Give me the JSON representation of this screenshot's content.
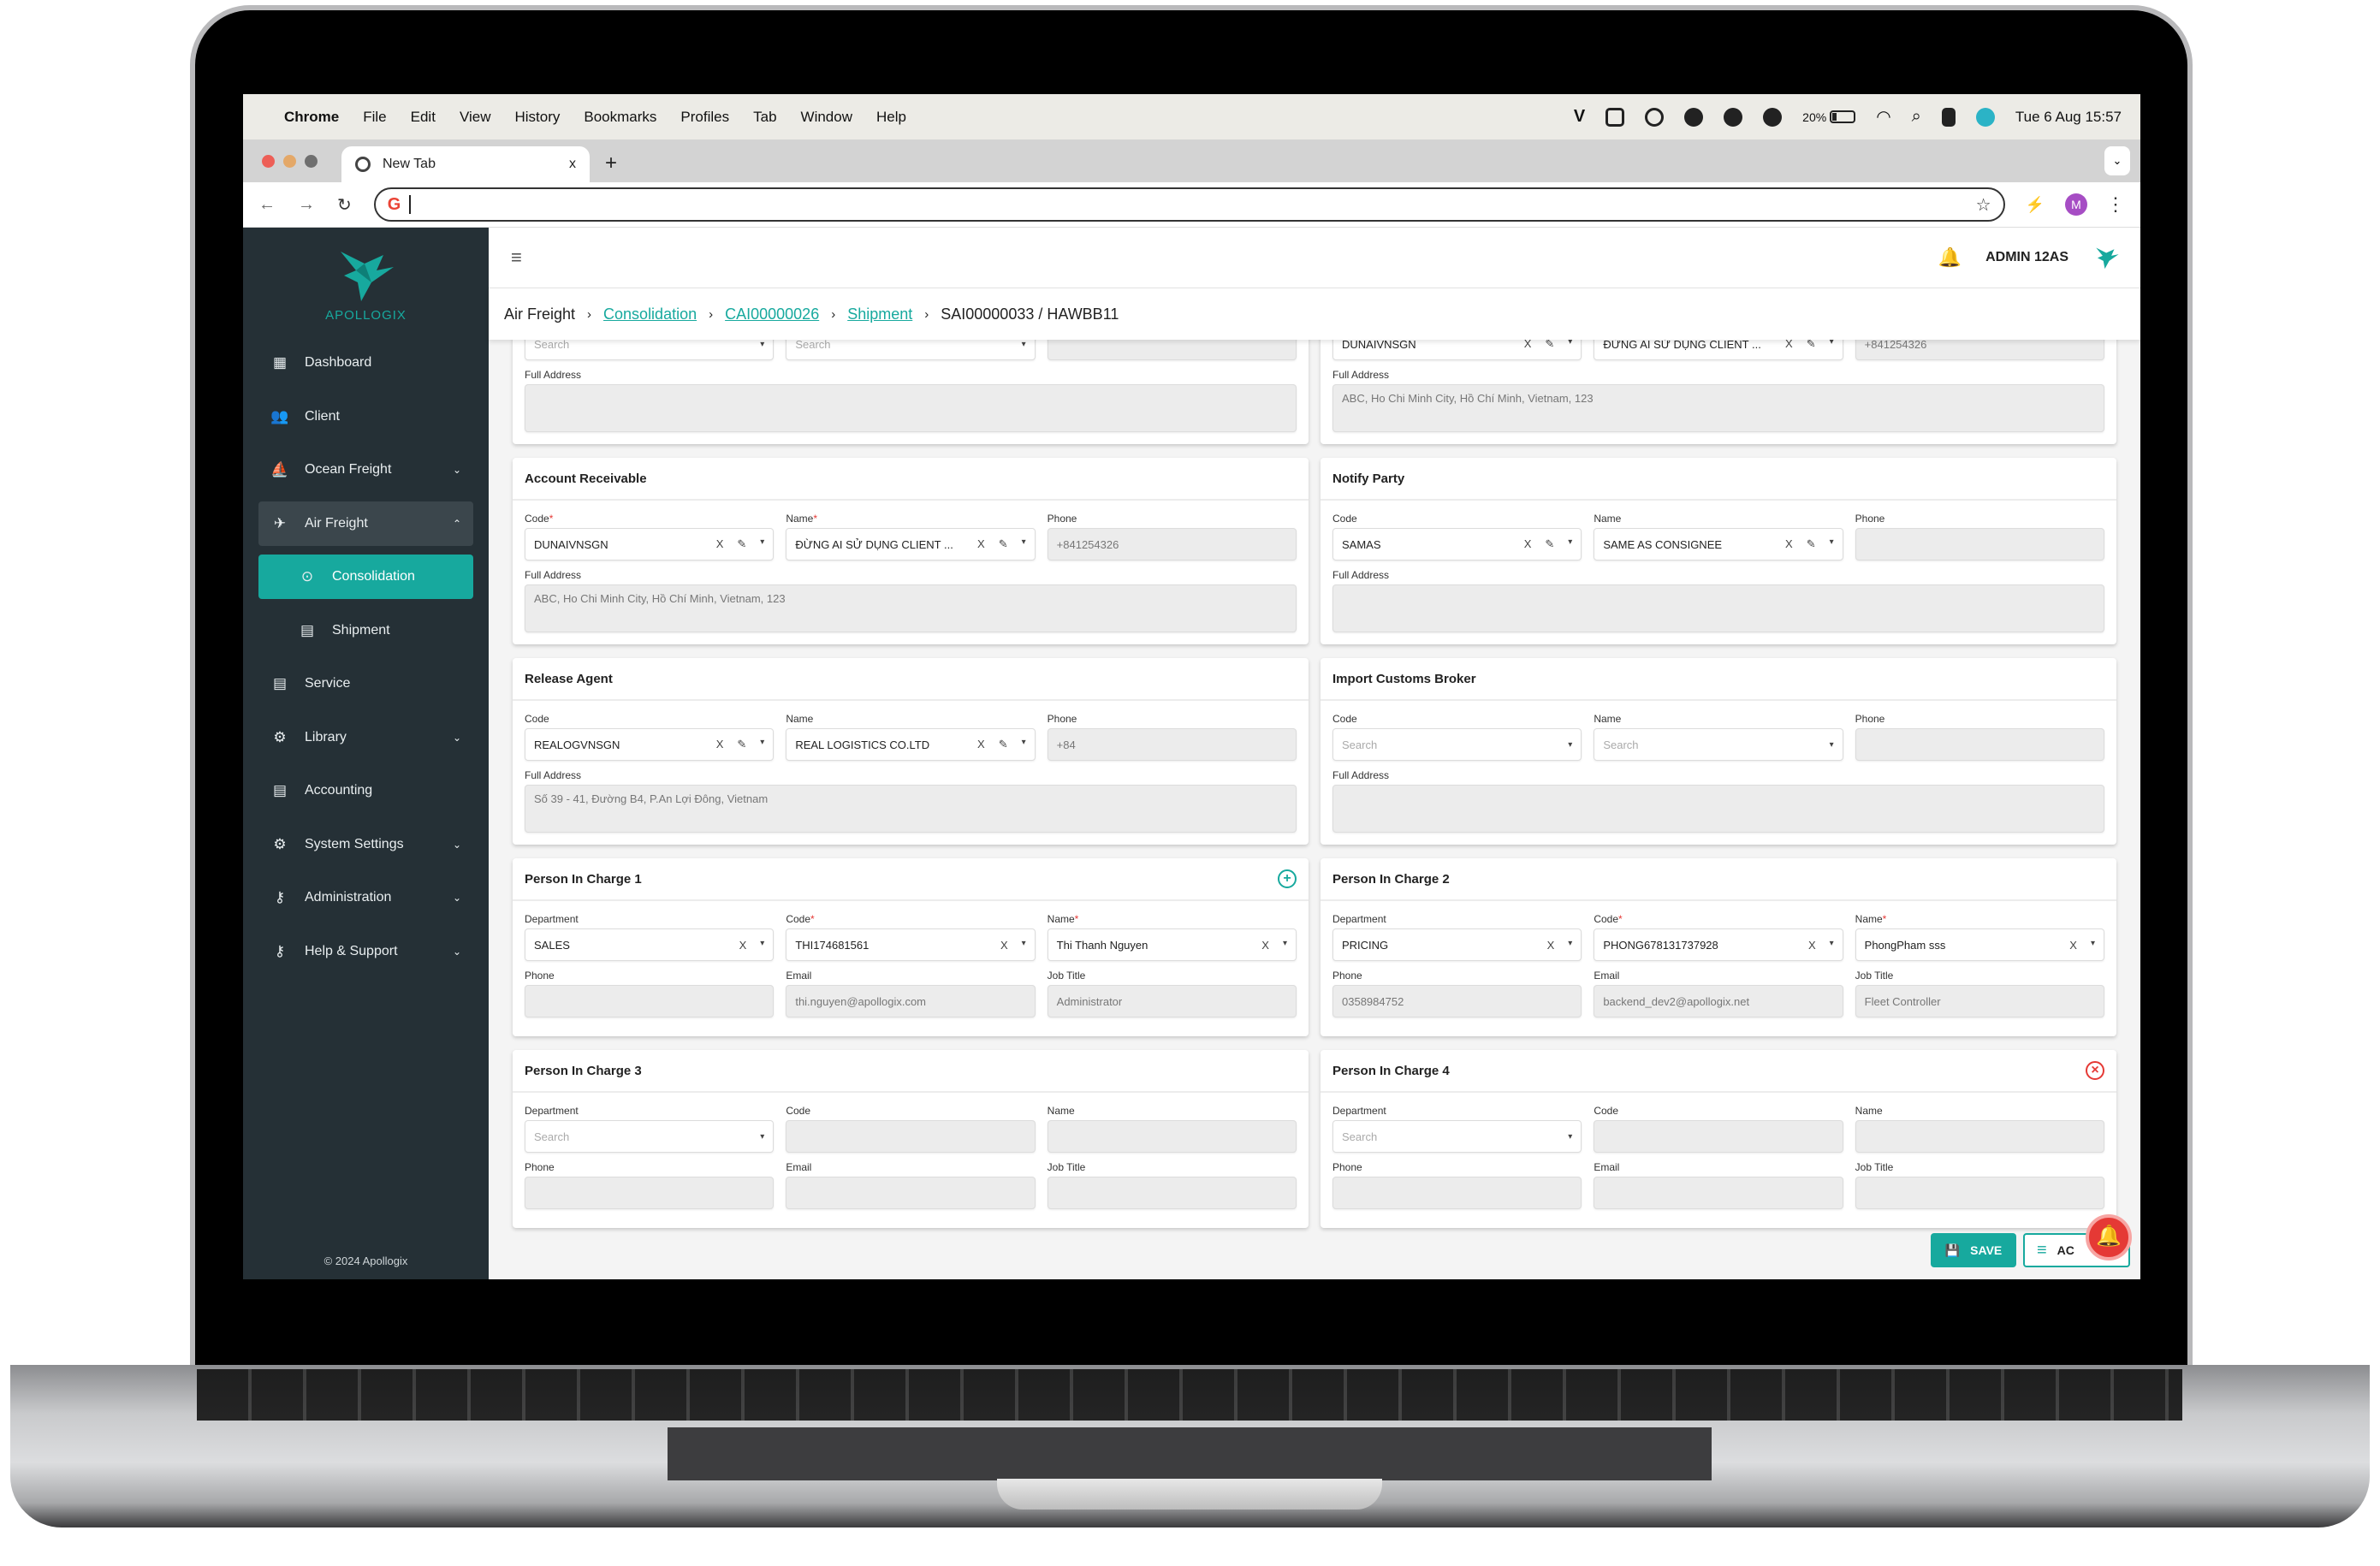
{
  "menubar": {
    "items": [
      "Chrome",
      "File",
      "Edit",
      "View",
      "History",
      "Bookmarks",
      "Profiles",
      "Tab",
      "Window",
      "Help"
    ],
    "battery_percent": "20%",
    "battery_level": 0.2,
    "datetime": "Tue 6 Aug  15:57",
    "tray_icons": [
      "vivaldi-v-icon",
      "teamviewer-icon",
      "creative-cloud-icon",
      "viber-icon",
      "grammarly-icon",
      "tasks-check-icon",
      "battery-icon",
      "wifi-icon",
      "spotlight-search-icon",
      "control-center-icon",
      "siri-icon"
    ]
  },
  "browser": {
    "tab_title": "New Tab",
    "tab_close": "x",
    "new_tab": "+",
    "address_value": "",
    "profile_initial": "M",
    "colors": {
      "traffic_red": "#ed5f57",
      "traffic_yellow": "#e4a868",
      "traffic_gray": "#6f6f6f",
      "profile": "#a64dc4"
    }
  },
  "app": {
    "brand": "APOLLOGIX",
    "user": "ADMIN 12AS",
    "accent": "#17a99e",
    "sidebar": {
      "items": [
        {
          "label": "Dashboard",
          "icon": "dashboard-icon",
          "chevron": ""
        },
        {
          "label": "Client",
          "icon": "client-group-icon",
          "chevron": ""
        },
        {
          "label": "Ocean Freight",
          "icon": "ship-icon",
          "chevron": "⌄"
        },
        {
          "label": "Air Freight",
          "icon": "airplane-icon",
          "chevron": "⌃"
        },
        {
          "label": "Consolidation",
          "icon": "consolidation-icon",
          "chevron": ""
        },
        {
          "label": "Shipment",
          "icon": "shipment-list-icon",
          "chevron": ""
        },
        {
          "label": "Service",
          "icon": "service-list-icon",
          "chevron": ""
        },
        {
          "label": "Library",
          "icon": "library-gear-icon",
          "chevron": "⌄"
        },
        {
          "label": "Accounting",
          "icon": "accounting-list-icon",
          "chevron": ""
        },
        {
          "label": "System Settings",
          "icon": "settings-gear-icon",
          "chevron": "⌄"
        },
        {
          "label": "Administration",
          "icon": "key-icon",
          "chevron": "⌄"
        },
        {
          "label": "Help & Support",
          "icon": "key-icon",
          "chevron": "⌄"
        }
      ],
      "copyright": "© 2024 Apollogix"
    },
    "breadcrumb": {
      "root": "Air Freight",
      "links": [
        "Consolidation",
        "CAI00000026",
        "Shipment"
      ],
      "current": "SAI00000033 / HAWBB11"
    },
    "partial_top_left": {
      "code_placeholder": "Search",
      "name_placeholder": "Search",
      "phone": "",
      "full_address_label": "Full Address",
      "full_address": ""
    },
    "partial_top_right": {
      "code": "DUNAIVNSGN",
      "name": "ĐỪNG AI SỬ DỤNG CLIENT ...",
      "phone": "+841254326",
      "full_address_label": "Full Address",
      "full_address": "ABC, Ho Chi Minh City, Hồ Chí Minh, Vietnam, 123"
    },
    "account_receivable": {
      "title": "Account Receivable",
      "code_label": "Code",
      "code": "DUNAIVNSGN",
      "name_label": "Name",
      "name": "ĐỪNG AI SỬ DỤNG CLIENT ...",
      "phone_label": "Phone",
      "phone": "+841254326",
      "address_label": "Full Address",
      "address": "ABC, Ho Chi Minh City, Hồ Chí Minh, Vietnam, 123"
    },
    "notify_party": {
      "title": "Notify Party",
      "code_label": "Code",
      "code": "SAMAS",
      "name_label": "Name",
      "name": "SAME AS CONSIGNEE",
      "phone_label": "Phone",
      "phone": "",
      "address_label": "Full Address",
      "address": ""
    },
    "release_agent": {
      "title": "Release Agent",
      "code_label": "Code",
      "code": "REALOGVNSGN",
      "name_label": "Name",
      "name": "REAL LOGISTICS CO.LTD",
      "phone_label": "Phone",
      "phone": "+84",
      "address_label": "Full Address",
      "address": "Số 39 - 41, Đường B4, P.An Lợi Đông, Vietnam"
    },
    "import_customs_broker": {
      "title": "Import Customs Broker",
      "code_label": "Code",
      "code_placeholder": "Search",
      "name_label": "Name",
      "name_placeholder": "Search",
      "phone_label": "Phone",
      "phone": "",
      "address_label": "Full Address",
      "address": ""
    },
    "pic1": {
      "title": "Person In Charge 1",
      "department_label": "Department",
      "department": "SALES",
      "code_label": "Code",
      "code": "THI174681561",
      "name_label": "Name",
      "name": "Thi Thanh Nguyen",
      "phone_label": "Phone",
      "phone": "",
      "email_label": "Email",
      "email": "thi.nguyen@apollogix.com",
      "job_label": "Job Title",
      "job": "Administrator"
    },
    "pic2": {
      "title": "Person In Charge 2",
      "department_label": "Department",
      "department": "PRICING",
      "code_label": "Code",
      "code": "PHONG678131737928",
      "name_label": "Name",
      "name": "PhongPham sss",
      "phone_label": "Phone",
      "phone": "0358984752",
      "email_label": "Email",
      "email": "backend_dev2@apollogix.net",
      "job_label": "Job Title",
      "job": "Fleet Controller"
    },
    "pic3": {
      "title": "Person In Charge 3",
      "department_label": "Department",
      "department_placeholder": "Search",
      "code_label": "Code",
      "name_label": "Name",
      "phone_label": "Phone",
      "email_label": "Email",
      "job_label": "Job Title"
    },
    "pic4": {
      "title": "Person In Charge 4",
      "department_label": "Department",
      "department_placeholder": "Search",
      "code_label": "Code",
      "name_label": "Name",
      "phone_label": "Phone",
      "email_label": "Email",
      "job_label": "Job Title"
    },
    "actions": {
      "save": "SAVE",
      "actions": "AC"
    },
    "required_marker": "*",
    "clear_glyph": "X",
    "edit_glyph": "✎",
    "dropdown_glyph": "▾"
  }
}
